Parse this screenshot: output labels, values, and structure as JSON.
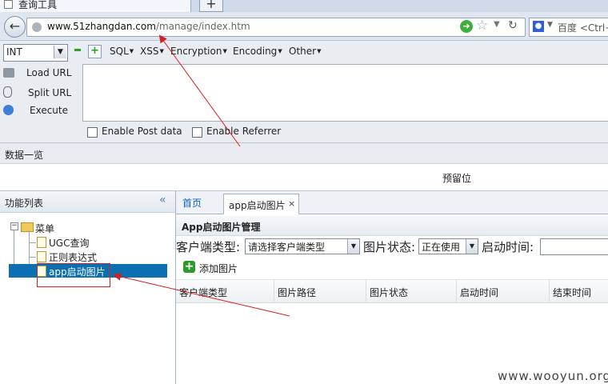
{
  "browser": {
    "tab_title": "查询工具",
    "new_tab": "+",
    "url_host": "www.51zhangdan.com",
    "url_path": "/manage/index.htm",
    "search_engine": "百度",
    "search_placeholder": "<Ctrl+"
  },
  "hackbar": {
    "int_select": "INT",
    "menus": [
      "SQL",
      "XSS",
      "Encryption",
      "Encoding",
      "Other"
    ],
    "buttons": [
      "Load URL",
      "Split URL",
      "Execute"
    ],
    "url_text": "",
    "post_data_label": "Enable Post data",
    "referrer_label": "Enable Referrer"
  },
  "data_section": {
    "title": "数据一览",
    "reserve": "预留位"
  },
  "left_panel": {
    "title": "功能列表",
    "collapse": "«",
    "tree_root": "菜单",
    "items": [
      "UGC查询",
      "正则表达式",
      "app启动图片"
    ]
  },
  "right_panel": {
    "tabs": [
      "首页",
      "app启动图片"
    ],
    "close": "×",
    "panel_title": "App启动图片管理",
    "client_type_label": "客户端类型:",
    "client_type_value": "请选择客户端类型",
    "image_status_label": "图片状态:",
    "image_status_value": "正在使用",
    "start_time_label": "启动时间:",
    "add_button": "添加图片",
    "columns": [
      "客户端类型",
      "图片路径",
      "图片状态",
      "启动时间",
      "结束时间"
    ]
  },
  "watermark": "www.wooyun.org",
  "colors": {
    "selected": "#0b6fb2",
    "annotation": "#d62020",
    "add_green": "#2b9a2b"
  }
}
